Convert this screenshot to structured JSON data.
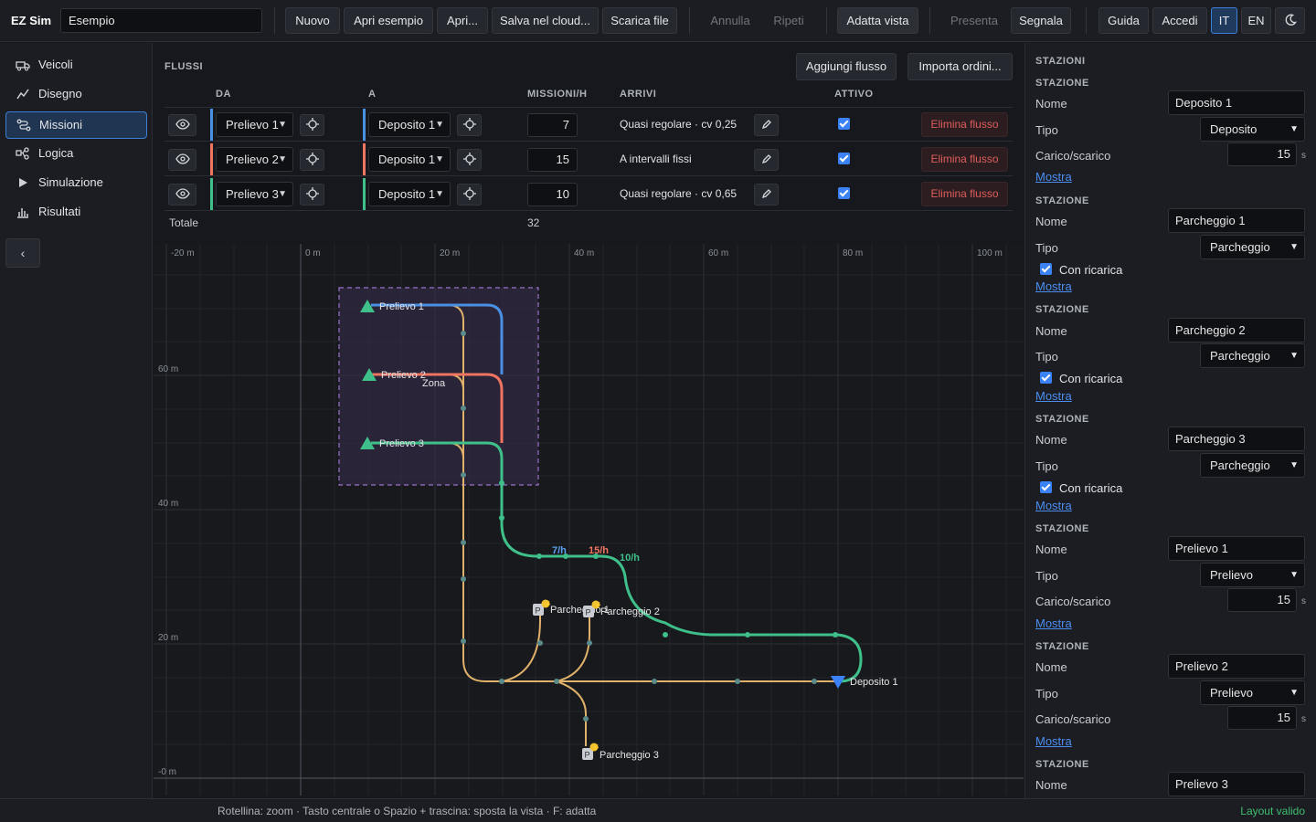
{
  "app": {
    "brand": "EZ Sim",
    "project_name": "Esempio"
  },
  "toolbar": {
    "new": "Nuovo",
    "open_example": "Apri esempio",
    "open": "Apri...",
    "save_cloud": "Salva nel cloud...",
    "download": "Scarica file",
    "undo": "Annulla",
    "redo": "Ripeti",
    "fit_view": "Adatta vista",
    "present": "Presenta",
    "report": "Segnala",
    "guide": "Guida",
    "login": "Accedi",
    "lang_it": "IT",
    "lang_en": "EN",
    "theme_icon": "moon-icon"
  },
  "sidebar": {
    "items": [
      {
        "label": "Veicoli",
        "icon": "truck-icon"
      },
      {
        "label": "Disegno",
        "icon": "pen-line-icon"
      },
      {
        "label": "Missioni",
        "icon": "route-icon"
      },
      {
        "label": "Logica",
        "icon": "workflow-icon"
      },
      {
        "label": "Simulazione",
        "icon": "play-icon"
      },
      {
        "label": "Risultati",
        "icon": "bar-chart-icon"
      }
    ],
    "selected": "Missioni",
    "collapse_icon": "chevron-left-icon"
  },
  "flows": {
    "title": "FLUSSI",
    "add_button": "Aggiungi flusso",
    "import_button": "Importa ordini...",
    "headers": {
      "from": "DA",
      "to": "A",
      "missions": "MISSIONI/H",
      "arrivals": "ARRIVI",
      "active": "ATTIVO"
    },
    "rows": [
      {
        "from": "Prelievo 1",
        "to": "Deposito 1",
        "missions": "7",
        "arrivals": "Quasi regolare · cv 0,25",
        "active": true,
        "color": "#4a90e2",
        "delete": "Elimina flusso"
      },
      {
        "from": "Prelievo 2",
        "to": "Deposito 1",
        "missions": "15",
        "arrivals": "A intervalli fissi",
        "active": true,
        "color": "#f07561",
        "delete": "Elimina flusso"
      },
      {
        "from": "Prelievo 3",
        "to": "Deposito 1",
        "missions": "10",
        "arrivals": "Quasi regolare · cv 0,65",
        "active": true,
        "color": "#3fbf8a",
        "delete": "Elimina flusso"
      }
    ],
    "total_label": "Totale",
    "total_value": "32"
  },
  "map": {
    "x_ticks": [
      "-20 m",
      "0 m",
      "20 m",
      "40 m",
      "60 m",
      "80 m",
      "100 m"
    ],
    "y_ticks": [
      "60 m",
      "40 m",
      "20 m",
      "-0 m"
    ],
    "zone_label": "Zona",
    "stations": {
      "p1": "Prelievo 1",
      "p2": "Prelievo 2",
      "p3": "Prelievo 3",
      "dep1": "Deposito 1",
      "park1": "Parcheggio 1",
      "park2": "Parcheggio 2",
      "park3": "Parcheggio 3"
    },
    "rates": {
      "r1": "7/h",
      "r2": "15/h",
      "r3": "10/h"
    }
  },
  "stations_panel": {
    "title": "STAZIONI",
    "section_label": "STAZIONE",
    "name_label": "Nome",
    "type_label": "Tipo",
    "load_label": "Carico/scarico",
    "charge_label": "Con ricarica",
    "show_link": "Mostra",
    "unit": "s",
    "items": [
      {
        "name": "Deposito 1",
        "type": "Deposito",
        "load": "15"
      },
      {
        "name": "Parcheggio 1",
        "type": "Parcheggio",
        "charge": true
      },
      {
        "name": "Parcheggio 2",
        "type": "Parcheggio",
        "charge": true
      },
      {
        "name": "Parcheggio 3",
        "type": "Parcheggio",
        "charge": true
      },
      {
        "name": "Prelievo 1",
        "type": "Prelievo",
        "load": "15"
      },
      {
        "name": "Prelievo 2",
        "type": "Prelievo",
        "load": "15"
      },
      {
        "name": "Prelievo 3"
      }
    ]
  },
  "status": {
    "hint": "Rotellina: zoom · Tasto centrale o Spazio + trascina: sposta la vista · F: adatta",
    "valid": "Layout valido"
  }
}
